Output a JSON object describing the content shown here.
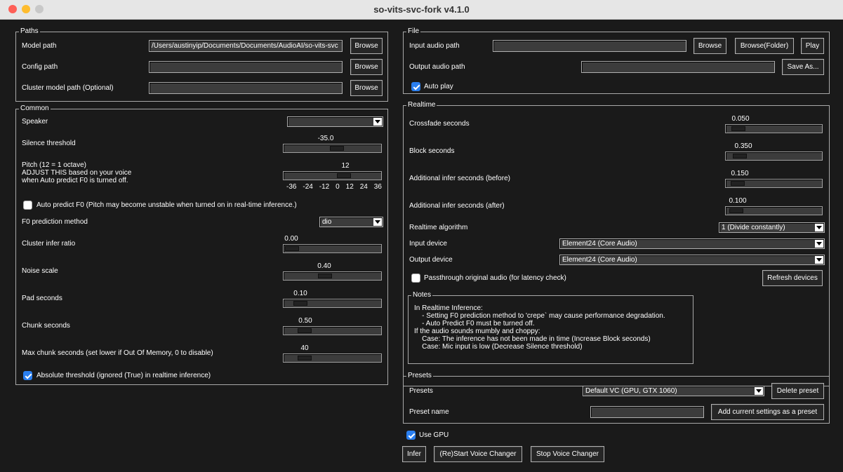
{
  "window": {
    "title": "so-vits-svc-fork v4.1.0"
  },
  "paths": {
    "legend": "Paths",
    "model_label": "Model path",
    "model_value": "/Users/austinyip/Documents/Documents/AudioAI/so-vits-svc",
    "config_label": "Config path",
    "config_value": "",
    "cluster_label": "Cluster model path (Optional)",
    "cluster_value": "",
    "browse_label": "Browse"
  },
  "common": {
    "legend": "Common",
    "speaker_label": "Speaker",
    "speaker_value": "",
    "silence_label": "Silence threshold",
    "silence_value": "-35.0",
    "silence_fraction": 0.55,
    "pitch_label_1": "Pitch (12 = 1 octave)",
    "pitch_label_2": "ADJUST THIS based on your voice",
    "pitch_label_3": "when Auto predict F0 is turned off.",
    "pitch_value": "12",
    "pitch_fraction": 0.63,
    "pitch_ticks": [
      "-36",
      "-24",
      "-12",
      "0",
      "12",
      "24",
      "36"
    ],
    "auto_predict_label": "Auto predict F0 (Pitch may become unstable when turned on in real-time inference.)",
    "auto_predict_checked": false,
    "f0_method_label": "F0 prediction method",
    "f0_method_value": "dio",
    "cluster_ratio_label": "Cluster infer ratio",
    "cluster_ratio_value": "0.00",
    "cluster_ratio_fraction": 0.0,
    "noise_label": "Noise scale",
    "noise_value": "0.40",
    "noise_fraction": 0.4,
    "pad_label": "Pad seconds",
    "pad_value": "0.10",
    "pad_fraction": 0.1,
    "chunk_label": "Chunk seconds",
    "chunk_value": "0.50",
    "chunk_fraction": 0.15,
    "max_chunk_label": "Max chunk seconds (set lower if Out Of Memory, 0 to disable)",
    "max_chunk_value": "40",
    "max_chunk_fraction": 0.15,
    "abs_threshold_label": "Absolute threshold (ignored (True) in realtime inference)",
    "abs_threshold_checked": true
  },
  "file": {
    "legend": "File",
    "input_label": "Input audio path",
    "input_value": "",
    "browse_label": "Browse",
    "browse_folder_label": "Browse(Folder)",
    "play_label": "Play",
    "output_label": "Output audio path",
    "output_value": "",
    "save_as_label": "Save As...",
    "auto_play_label": "Auto play",
    "auto_play_checked": true
  },
  "realtime": {
    "legend": "Realtime",
    "crossfade_label": "Crossfade seconds",
    "crossfade_value": "0.050",
    "crossfade_fraction": 0.05,
    "block_label": "Block seconds",
    "block_value": "0.350",
    "block_fraction": 0.07,
    "infer_before_label": "Additional infer seconds (before)",
    "infer_before_value": "0.150",
    "infer_before_fraction": 0.04,
    "infer_after_label": "Additional infer seconds (after)",
    "infer_after_value": "0.100",
    "infer_after_fraction": 0.03,
    "algorithm_label": "Realtime algorithm",
    "algorithm_value": "1 (Divide constantly)",
    "input_device_label": "Input device",
    "input_device_value": "Element24 (Core Audio)",
    "output_device_label": "Output device",
    "output_device_value": "Element24 (Core Audio)",
    "passthrough_label": "Passthrough original audio (for latency check)",
    "passthrough_checked": false,
    "refresh_label": "Refresh devices",
    "notes_legend": "Notes",
    "notes_lines": [
      "In Realtime Inference:",
      "    - Setting F0 prediction method to 'crepe` may cause performance degradation.",
      "    - Auto Predict F0 must be turned off.",
      "If the audio sounds mumbly and choppy:",
      "    Case: The inference has not been made in time (Increase Block seconds)",
      "    Case: Mic input is low (Decrease Silence threshold)"
    ]
  },
  "presets": {
    "legend": "Presets",
    "presets_label": "Presets",
    "presets_value": "Default VC (GPU, GTX 1060)",
    "delete_label": "Delete preset",
    "name_label": "Preset name",
    "name_value": "",
    "add_label": "Add current settings as a preset"
  },
  "bottom": {
    "use_gpu_label": "Use GPU",
    "use_gpu_checked": true,
    "infer_label": "Infer",
    "restart_label": "(Re)Start Voice Changer",
    "stop_label": "Stop Voice Changer"
  },
  "colors": {
    "background": "#1a1a1a",
    "accent": "#2a7ff0",
    "field": "#3c3c3c"
  }
}
